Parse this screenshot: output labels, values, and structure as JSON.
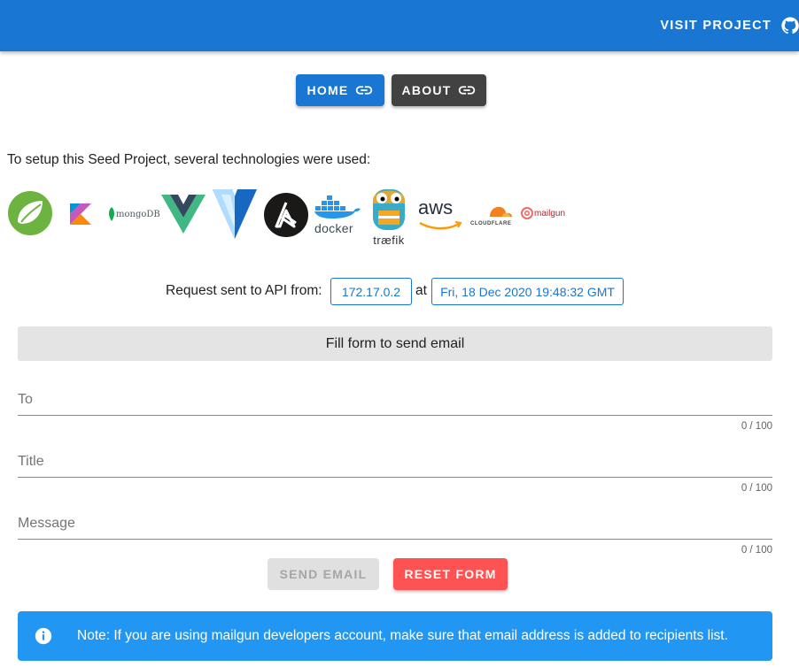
{
  "header": {
    "visit_label": "VISIT PROJECT",
    "icon": "github-icon",
    "color": "#1976d2"
  },
  "nav": {
    "home_label": "HOME",
    "about_label": "ABOUT",
    "home_color": "#1976d2",
    "about_color": "#424242"
  },
  "intro": "To setup this Seed Project, several technologies were used:",
  "technologies": [
    {
      "name": "spring",
      "icon": "spring-logo-icon"
    },
    {
      "name": "kotlin",
      "icon": "kotlin-logo-icon"
    },
    {
      "name": "mongoDB",
      "icon": "mongodb-logo-icon"
    },
    {
      "name": "vue",
      "icon": "vue-logo-icon"
    },
    {
      "name": "vuetify",
      "icon": "vuetify-logo-icon"
    },
    {
      "name": "ansible",
      "icon": "ansible-logo-icon"
    },
    {
      "name": "docker",
      "icon": "docker-logo-icon"
    },
    {
      "name": "træfik",
      "icon": "traefik-logo-icon"
    },
    {
      "name": "aws",
      "icon": "aws-logo-icon"
    },
    {
      "name": "CLOUDFLARE",
      "icon": "cloudflare-logo-icon"
    },
    {
      "name": "mailgun",
      "icon": "mailgun-logo-icon"
    }
  ],
  "request": {
    "label": "Request sent to API from:",
    "ip": "172.17.0.2",
    "at": "at",
    "date": "Fri, 18 Dec 2020 19:48:32 GMT"
  },
  "form": {
    "header": "Fill form to send email",
    "fields": [
      {
        "label": "To",
        "value": "",
        "counter": "0 / 100"
      },
      {
        "label": "Title",
        "value": "",
        "counter": "0 / 100"
      },
      {
        "label": "Message",
        "value": "",
        "counter": "0 / 100"
      }
    ],
    "send_label": "SEND EMAIL",
    "reset_label": "RESET FORM",
    "reset_color": "#ff5252"
  },
  "alert": {
    "icon": "info-icon",
    "text": "Note: If you are using mailgun developers account, make sure that email address is added to recipients list.",
    "color": "#2196f3"
  }
}
